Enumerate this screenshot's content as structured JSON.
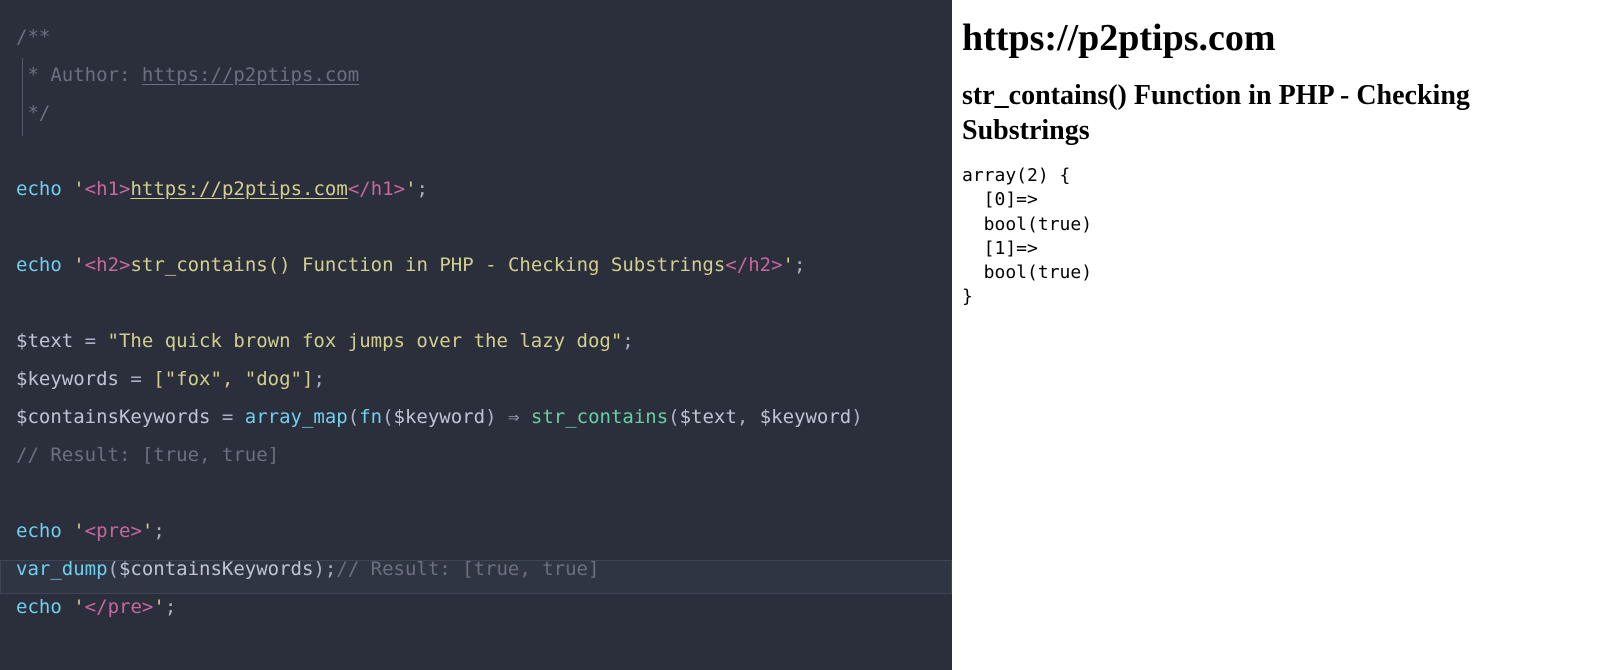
{
  "editor": {
    "comment_open": "/**",
    "comment_star": " *",
    "author_label": " Author: ",
    "author_link": "https://p2ptips.com",
    "comment_close": " */",
    "echo": "echo",
    "q": "'",
    "lt": "<",
    "gt": ">",
    "slash": "/",
    "h1": "h1",
    "h2": "h2",
    "pre": "pre",
    "link_text": "https://p2ptips.com",
    "semicolon": ";",
    "h2_text": "str_contains() Function in PHP - Checking Substrings",
    "text_var": "$text",
    "eq": " = ",
    "text_str": "\"The quick brown fox jumps over the lazy dog\"",
    "keywords_var": "$keywords",
    "keywords_str": "[\"fox\", \"dog\"]",
    "contains_var": "$containsKeywords",
    "array_map": "array_map",
    "fn": "fn",
    "keyword_var": "$keyword",
    "arrow": "⇒",
    "str_contains": "str_contains",
    "paren_open": "(",
    "paren_close": ")",
    "comma": ", ",
    "comment_result": "// Result: [true, true]",
    "var_dump": "var_dump"
  },
  "preview": {
    "h1": "https://p2ptips.com",
    "h2": "str_contains() Function in PHP - Checking Substrings",
    "output": "array(2) {\n  [0]=>\n  bool(true)\n  [1]=>\n  bool(true)\n}"
  }
}
